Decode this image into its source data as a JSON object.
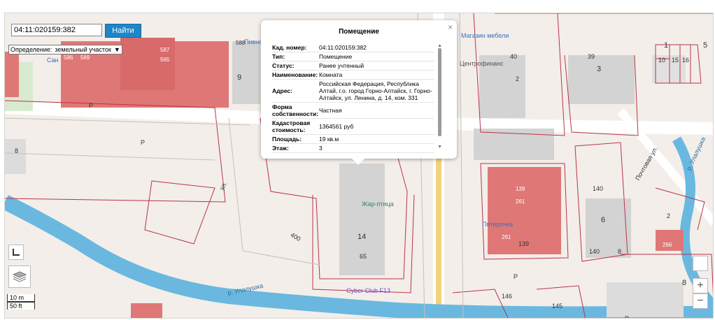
{
  "search": {
    "value": "04:11:020159:382",
    "button_label": "Найти"
  },
  "definition": {
    "label": "Определение:",
    "selected": "земельный участок"
  },
  "popup": {
    "title": "Помещение",
    "rows": [
      {
        "key": "Кад. номер:",
        "value": "04:11:020159:382"
      },
      {
        "key": "Тип:",
        "value": "Помещение"
      },
      {
        "key": "Статус:",
        "value": "Ранее учтенный"
      },
      {
        "key": "Наименование:",
        "value": "Комната"
      },
      {
        "key": "Адрес:",
        "value": "Российская Федерация, Республика Алтай, г.о. город Горно-Алтайск, г. Горно-Алтайск, ул. Ленина, д. 14, ком. 331"
      },
      {
        "key": "Форма собственности:",
        "value": "Частная"
      },
      {
        "key": "Кадастровая стоимость:",
        "value": "1364561 руб"
      },
      {
        "key": "Площадь:",
        "value": "19 кв.м"
      },
      {
        "key": "Этаж:",
        "value": "3"
      }
    ]
  },
  "map_labels": {
    "l587": "587",
    "l565": "565",
    "l586": "586",
    "l569": "569",
    "l588": "588",
    "l9": "9",
    "lP1": "Р",
    "lP2": "Р",
    "lP3": "Р",
    "l8a": "8",
    "l14": "14",
    "l65": "65",
    "l400": "400",
    "l3": "3",
    "l40": "40",
    "l39": "39",
    "l2a": "2",
    "l139a": "139",
    "l261a": "261",
    "l261b": "261",
    "l139b": "139",
    "l140a": "140",
    "l140b": "140",
    "l6": "6",
    "l8b": "8",
    "l266": "266",
    "l2b": "2",
    "l8c": "8",
    "l146": "146",
    "l145": "145",
    "lP4": "Р",
    "l1": "1",
    "l10": "10",
    "l15": "15",
    "l16": "16",
    "l5": "5"
  },
  "pois": {
    "store": "Магазин мебели",
    "finance": "Центрофинанс",
    "zhar": "Жар-птица",
    "cyber": "Cyber Club F13",
    "pater": "Пятерочка",
    "pub": "Пивной бар",
    "san": "Сан"
  },
  "streets": {
    "river": "р. Улалушка",
    "river2": "р. Улалушка",
    "pochtovaya": "Почтовая ул.",
    "street3": "ул."
  },
  "scale": {
    "meters": "10 m",
    "feet": "50 ft"
  },
  "controls": {
    "zoom_in": "+",
    "zoom_out": "−"
  }
}
